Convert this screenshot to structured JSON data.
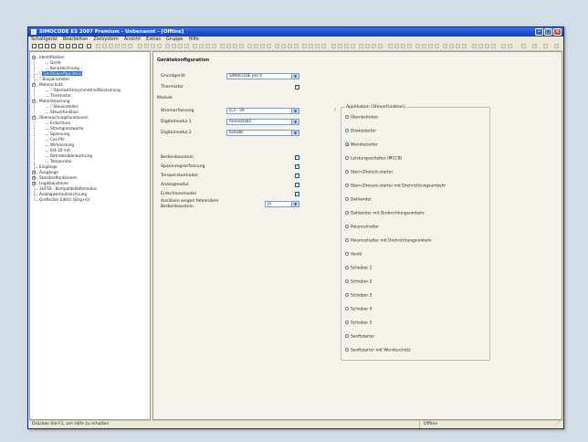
{
  "window": {
    "title": "SIMOCODE ES 2007 Premium - Unbenannt - [Offline]"
  },
  "menu": [
    "Schaltgerät",
    "Bearbeiten",
    "Zielsystem",
    "Ansicht",
    "Extras",
    "Gruppe",
    "Hilfe"
  ],
  "tree": {
    "items": [
      {
        "label": "Identifikation",
        "level": 0,
        "expander": "-"
      },
      {
        "label": "Gerät",
        "level": 1
      },
      {
        "label": "Kennzeichnung",
        "level": 1
      },
      {
        "label": "Gerätekonfiguration",
        "level": 0,
        "warn": true,
        "selected": true
      },
      {
        "label": "Busparameter",
        "level": 0,
        "warn": true
      },
      {
        "label": "Motorschutz",
        "level": 0,
        "expander": "-"
      },
      {
        "label": "Überlast/Unsymmetrie/Blockierung",
        "level": 1,
        "warn": true
      },
      {
        "label": "Thermistor",
        "level": 1
      },
      {
        "label": "Motorsteuerung",
        "level": 0,
        "expander": "-"
      },
      {
        "label": "Steuerstellen",
        "level": 1,
        "warn": true
      },
      {
        "label": "Steuerfunktion",
        "level": 1
      },
      {
        "label": "Überwachungsfunktionen",
        "level": 0,
        "expander": "-"
      },
      {
        "label": "Erdschluss",
        "level": 1
      },
      {
        "label": "Stromgrenzwerte",
        "level": 1
      },
      {
        "label": "Spannung",
        "level": 1
      },
      {
        "label": "Cos-Phi",
        "level": 1
      },
      {
        "label": "Wirkleistung",
        "level": 1
      },
      {
        "label": "0/4-20 mA",
        "level": 1
      },
      {
        "label": "Betriebsüberwachung",
        "level": 1
      },
      {
        "label": "Temperatur",
        "level": 1
      },
      {
        "label": "Eingänge",
        "level": 0
      },
      {
        "label": "Ausgänge",
        "level": 0,
        "expander": "+"
      },
      {
        "label": "Standardfunktionen",
        "level": 0,
        "expander": "+"
      },
      {
        "label": "Logikbausteine",
        "level": 0,
        "expander": "+"
      },
      {
        "label": "3UF50 - Kompatibilitätsmodus",
        "level": 0
      },
      {
        "label": "Analogwertaufzeichnung",
        "level": 0
      },
      {
        "label": "Grafischer Editor  (Strg+G)",
        "level": 0
      }
    ]
  },
  "config": {
    "heading": "Gerätekonfiguration",
    "grundgeraet_label": "Grundgerät",
    "grundgeraet_value": "SIMOCODE pro V",
    "thermistor_label": "Thermistor",
    "module_label": "Module",
    "stromerfassung_label": "Stromerfassung",
    "stromerfassung_value": "0,3 - 3A",
    "digital1_label": "Digitalmodul 1",
    "digital1_value": "monostabil",
    "digital2_label": "Digitalmodul 2",
    "digital2_value": "bistabil",
    "checks": [
      {
        "label": "Bedienbaustein",
        "checked": true
      },
      {
        "label": "Spannungserfassung",
        "checked": true
      },
      {
        "label": "Temperaturmodul",
        "checked": true
      },
      {
        "label": "Analogmodul",
        "checked": true
      },
      {
        "label": "Erdschlussmodul",
        "checked": true
      }
    ],
    "ausloese_label_1": "Auslösen wegen fehlendem",
    "ausloese_label_2": "Bedienbaustein",
    "ausloese_value": "ja"
  },
  "application": {
    "title": "Applikation (Steuerfunktion)",
    "options": [
      {
        "label": "Überlastrelais",
        "checked": false
      },
      {
        "label": "Direktstarter",
        "checked": false
      },
      {
        "label": "Wendestarter",
        "checked": true
      },
      {
        "label": "Leistungsschalter (MCCB)",
        "checked": false
      },
      {
        "label": "Stern-Dreieck-starter",
        "checked": false
      },
      {
        "label": "Stern-Dreieck-starter mit Drehrichtungsumkehr",
        "checked": false
      },
      {
        "label": "Dahlander",
        "checked": false
      },
      {
        "label": "Dahlander mit Drehrichtungsumkehr",
        "checked": false
      },
      {
        "label": "Polumschalter",
        "checked": false
      },
      {
        "label": "Polumschalter mit Drehrichtungsumkehr",
        "checked": false
      },
      {
        "label": "Ventil",
        "checked": false
      },
      {
        "label": "Schieber 1",
        "checked": false
      },
      {
        "label": "Schieber 2",
        "checked": false
      },
      {
        "label": "Schieber 3",
        "checked": false
      },
      {
        "label": "Schieber 4",
        "checked": false
      },
      {
        "label": "Schieber 5",
        "checked": false
      },
      {
        "label": "Sanftstarter",
        "checked": false
      },
      {
        "label": "Sanftstarter mit Wendeschütz",
        "checked": false
      }
    ]
  },
  "status": {
    "help": "Drücken Sie F1, um Hilfe zu erhalten",
    "mode": "Offline"
  }
}
